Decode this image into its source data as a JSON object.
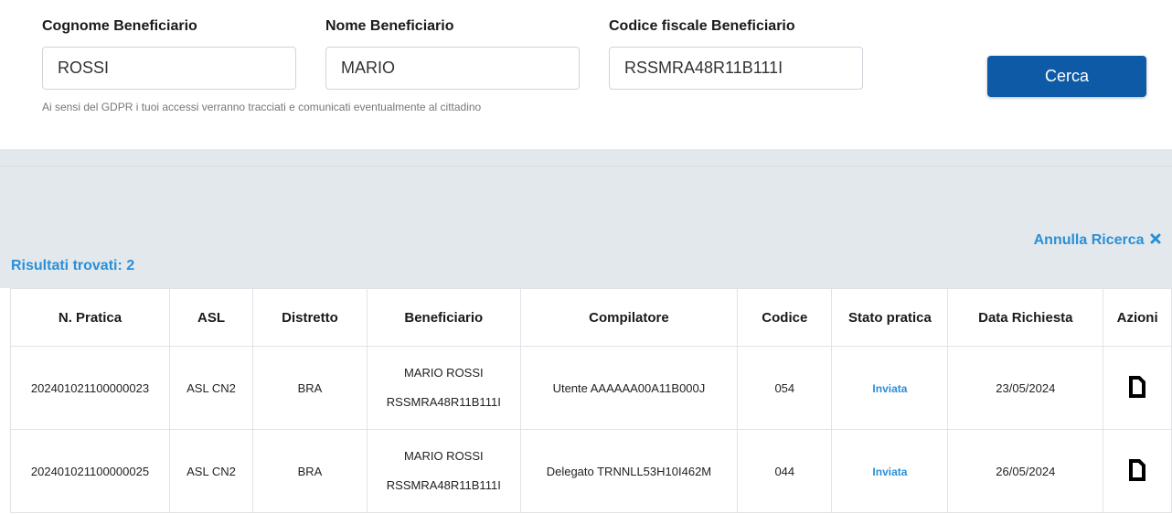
{
  "search": {
    "cognome": {
      "label": "Cognome Beneficiario",
      "value": "ROSSI"
    },
    "nome": {
      "label": "Nome Beneficiario",
      "value": "MARIO"
    },
    "codice_fiscale": {
      "label": "Codice fiscale Beneficiario",
      "value": "RSSMRA48R11B111I"
    },
    "gdpr_notice": "Ai sensi del GDPR i tuoi accessi verranno tracciati e comunicati eventualmente al cittadino",
    "button_label": "Cerca"
  },
  "results": {
    "annulla_label": "Annulla Ricerca",
    "annulla_icon": "close-icon",
    "count_label": "Risultati trovati: 2",
    "columns": [
      "N. Pratica",
      "ASL",
      "Distretto",
      "Beneficiario",
      "Compilatore",
      "Codice",
      "Stato pratica",
      "Data Richiesta",
      "Azioni"
    ],
    "rows": [
      {
        "pratica": "202401021100000023",
        "asl": "ASL CN2",
        "distretto": "BRA",
        "beneficiario_nome": "MARIO ROSSI",
        "beneficiario_cf": "RSSMRA48R11B111I",
        "compilatore": "Utente AAAAAA00A11B000J",
        "codice": "054",
        "stato": "Inviata",
        "data": "23/05/2024",
        "azione_icon": "document-icon"
      },
      {
        "pratica": "202401021100000025",
        "asl": "ASL CN2",
        "distretto": "BRA",
        "beneficiario_nome": "MARIO ROSSI",
        "beneficiario_cf": "RSSMRA48R11B111I",
        "compilatore": "Delegato TRNNLL53H10I462M",
        "codice": "044",
        "stato": "Inviata",
        "data": "26/05/2024",
        "azione_icon": "document-icon"
      }
    ]
  },
  "colors": {
    "primary_button": "#0e5aa7",
    "link_blue": "#2b8fd6",
    "band_background": "#e3e8ec"
  }
}
